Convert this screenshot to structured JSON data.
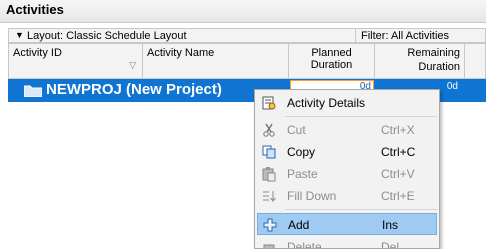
{
  "panel": {
    "title": "Activities"
  },
  "layout_bar": {
    "layout_label": "Layout: Classic Schedule Layout",
    "filter_label": "Filter: All Activities"
  },
  "columns": {
    "activity_id": "Activity ID",
    "activity_name": "Activity Name",
    "planned_duration": "Planned Duration",
    "remaining_duration_line1": "Remaining",
    "remaining_duration_line2": "Duration"
  },
  "project_row": {
    "name": "NEWPROJ  (New Project)",
    "planned_duration": "0d",
    "remaining_duration": "0d",
    "selection_color": "#0f74d2"
  },
  "context_menu": {
    "items": [
      {
        "label": "Activity Details",
        "shortcut": "",
        "icon": "activity-details-icon",
        "enabled": true
      },
      {
        "label": "Cut",
        "shortcut": "Ctrl+X",
        "icon": "scissors-icon",
        "enabled": false
      },
      {
        "label": "Copy",
        "shortcut": "Ctrl+C",
        "icon": "copy-icon",
        "enabled": true
      },
      {
        "label": "Paste",
        "shortcut": "Ctrl+V",
        "icon": "paste-icon",
        "enabled": false
      },
      {
        "label": "Fill Down",
        "shortcut": "Ctrl+E",
        "icon": "fill-down-icon",
        "enabled": false
      },
      {
        "label": "Add",
        "shortcut": "Ins",
        "icon": "plus-icon",
        "enabled": true,
        "highlighted": true
      },
      {
        "label": "Delete",
        "shortcut": "Del",
        "icon": "delete-icon",
        "enabled": false
      }
    ]
  }
}
